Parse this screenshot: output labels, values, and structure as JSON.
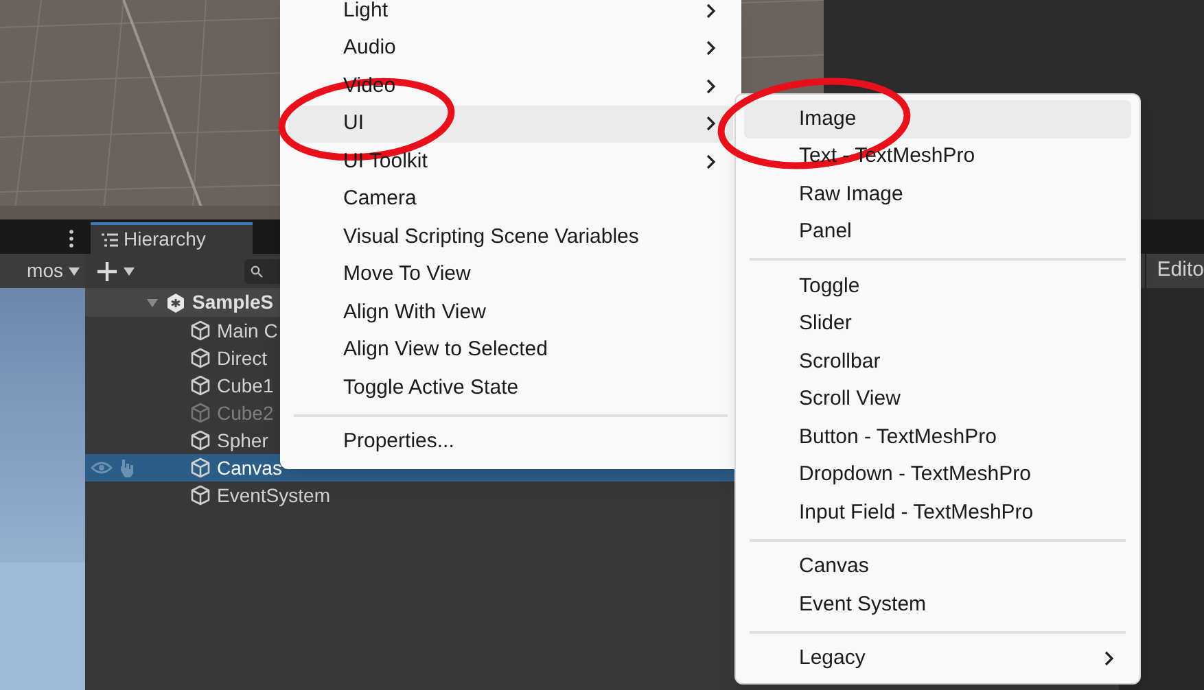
{
  "scene_toolbar": {
    "gizmos_label": "mos"
  },
  "hierarchy": {
    "tab": "Hierarchy",
    "scene": {
      "name": "SampleS",
      "expanded": true,
      "children": [
        {
          "name": "Main C",
          "active": true,
          "selected": false
        },
        {
          "name": "Direct",
          "active": true,
          "selected": false
        },
        {
          "name": "Cube1",
          "active": true,
          "selected": false
        },
        {
          "name": "Cube2",
          "active": false,
          "selected": false
        },
        {
          "name": "Spher",
          "active": true,
          "selected": false
        },
        {
          "name": "Canvas",
          "active": true,
          "selected": true
        },
        {
          "name": "EventSystem",
          "active": true,
          "selected": false
        }
      ]
    }
  },
  "inspector_tab": "Edito",
  "context_menu": {
    "items": [
      {
        "kind": "item",
        "label": "Light",
        "submenu": true,
        "highlighted": false
      },
      {
        "kind": "item",
        "label": "Audio",
        "submenu": true,
        "highlighted": false
      },
      {
        "kind": "item",
        "label": "Video",
        "submenu": true,
        "highlighted": false
      },
      {
        "kind": "item",
        "label": "UI",
        "submenu": true,
        "highlighted": true
      },
      {
        "kind": "item",
        "label": "UI Toolkit",
        "submenu": true,
        "highlighted": false
      },
      {
        "kind": "item",
        "label": "Camera",
        "submenu": false,
        "highlighted": false
      },
      {
        "kind": "item",
        "label": "Visual Scripting Scene Variables",
        "submenu": false,
        "highlighted": false
      },
      {
        "kind": "item",
        "label": "Move To View",
        "submenu": false,
        "highlighted": false
      },
      {
        "kind": "item",
        "label": "Align With View",
        "submenu": false,
        "highlighted": false
      },
      {
        "kind": "item",
        "label": "Align View to Selected",
        "submenu": false,
        "highlighted": false
      },
      {
        "kind": "item",
        "label": "Toggle Active State",
        "submenu": false,
        "highlighted": false
      },
      {
        "kind": "separator"
      },
      {
        "kind": "item",
        "label": "Properties...",
        "submenu": false,
        "highlighted": false
      }
    ]
  },
  "ui_submenu": {
    "items": [
      {
        "kind": "item",
        "label": "Image",
        "submenu": false,
        "highlighted": true
      },
      {
        "kind": "item",
        "label": "Text - TextMeshPro",
        "submenu": false,
        "highlighted": false
      },
      {
        "kind": "item",
        "label": "Raw Image",
        "submenu": false,
        "highlighted": false
      },
      {
        "kind": "item",
        "label": "Panel",
        "submenu": false,
        "highlighted": false
      },
      {
        "kind": "separator"
      },
      {
        "kind": "item",
        "label": "Toggle",
        "submenu": false,
        "highlighted": false
      },
      {
        "kind": "item",
        "label": "Slider",
        "submenu": false,
        "highlighted": false
      },
      {
        "kind": "item",
        "label": "Scrollbar",
        "submenu": false,
        "highlighted": false
      },
      {
        "kind": "item",
        "label": "Scroll View",
        "submenu": false,
        "highlighted": false
      },
      {
        "kind": "item",
        "label": "Button - TextMeshPro",
        "submenu": false,
        "highlighted": false
      },
      {
        "kind": "item",
        "label": "Dropdown - TextMeshPro",
        "submenu": false,
        "highlighted": false
      },
      {
        "kind": "item",
        "label": "Input Field - TextMeshPro",
        "submenu": false,
        "highlighted": false
      },
      {
        "kind": "separator"
      },
      {
        "kind": "item",
        "label": "Canvas",
        "submenu": false,
        "highlighted": false
      },
      {
        "kind": "item",
        "label": "Event System",
        "submenu": false,
        "highlighted": false
      },
      {
        "kind": "separator"
      },
      {
        "kind": "item",
        "label": "Legacy",
        "submenu": true,
        "highlighted": false
      }
    ]
  }
}
